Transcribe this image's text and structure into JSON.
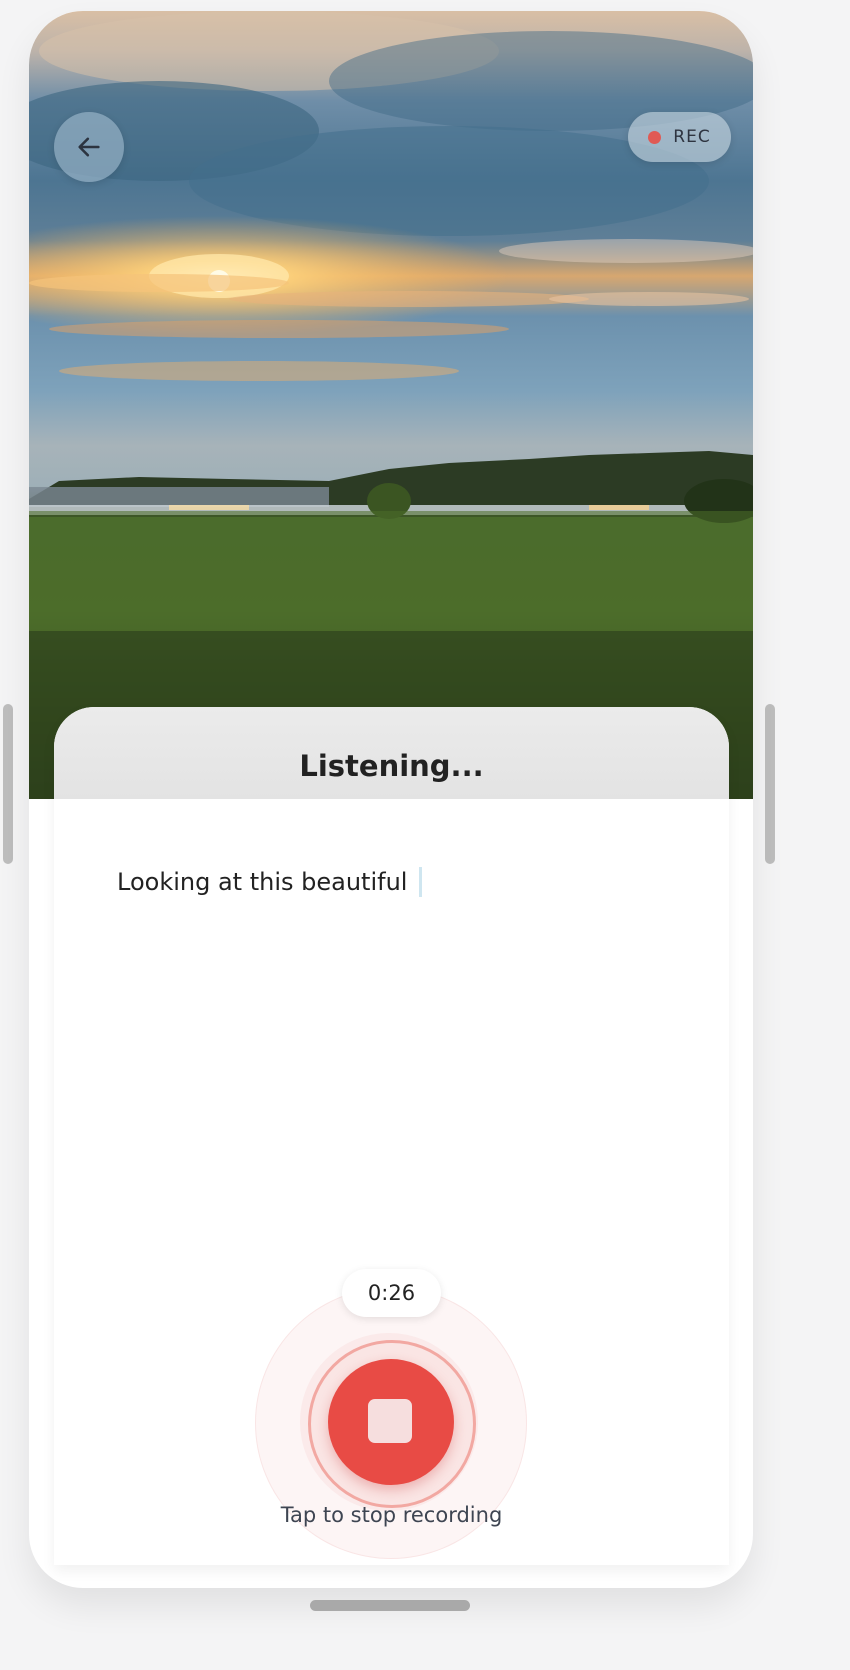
{
  "header": {
    "back_icon": "arrow-left-icon",
    "rec_label": "REC",
    "rec_dot_color": "#e05a54"
  },
  "sheet": {
    "title": "Listening...",
    "transcript": "Looking at this beautiful"
  },
  "recorder": {
    "timer": "0:26",
    "stop_icon": "stop-icon",
    "hint": "Tap to stop recording",
    "accent_color": "#e84b45"
  }
}
